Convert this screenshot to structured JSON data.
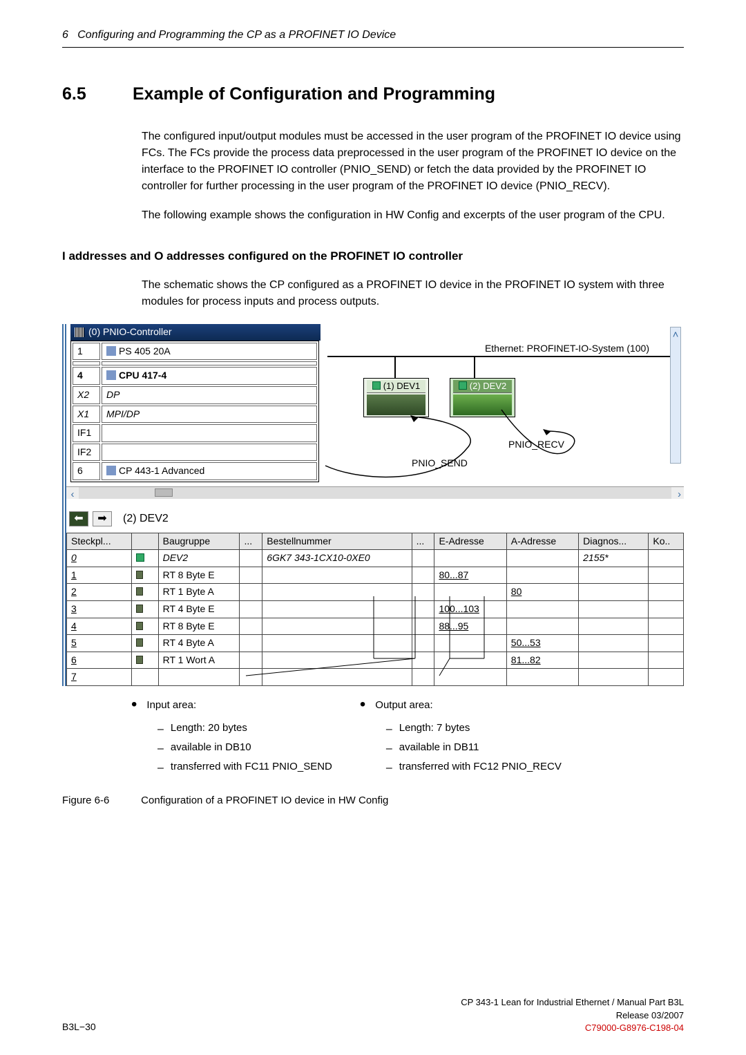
{
  "page_header": {
    "num": "6",
    "text": "Configuring and Programming the CP as a PROFINET IO Device"
  },
  "h1": {
    "num": "6.5",
    "title": "Example of Configuration and Programming"
  },
  "p1": "The configured input/output modules must be accessed in the user program of the PROFINET IO device using FCs. The FCs provide the process data preprocessed in the user program of the PROFINET IO device on the interface to the PROFINET IO controller (PNIO_SEND) or fetch the data provided by the PROFINET IO controller for further processing in the user program of the PROFINET IO device (PNIO_RECV).",
  "p2": "The following example shows the configuration in HW Config and excerpts of the user program of the CPU.",
  "h2": "I addresses and O addresses configured on the PROFINET IO controller",
  "p3": "The schematic shows the CP configured as a PROFINET IO device in the PROFINET IO system with three modules for process inputs and process outputs.",
  "hw": {
    "rack_title": "(0) PNIO-Controller",
    "rack_rows": [
      {
        "slot": "1",
        "name": "PS 405 20A",
        "b": true
      },
      {
        "slot": "",
        "name": ""
      },
      {
        "slot": "4",
        "name": "CPU 417-4",
        "b": true,
        "bold": true
      },
      {
        "slot": "X2",
        "name": "DP",
        "it": true
      },
      {
        "slot": "X1",
        "name": "MPI/DP",
        "it": true
      },
      {
        "slot": "IF1",
        "name": ""
      },
      {
        "slot": "IF2",
        "name": ""
      },
      {
        "slot": "6",
        "name": "CP 443-1 Advanced",
        "b": true
      }
    ],
    "net_label": "Ethernet: PROFINET-IO-System (100)",
    "dev1": "(1) DEV1",
    "dev2": "(2) DEV2",
    "pnio_send": "PNIO_SEND",
    "pnio_recv": "PNIO_RECV",
    "nav_label": "(2)  DEV2",
    "columns": [
      "Steckpl...",
      "",
      "Baugruppe",
      "...",
      "Bestellnummer",
      "...",
      "E-Adresse",
      "A-Adresse",
      "Diagnos...",
      "Ko.."
    ],
    "rows": [
      {
        "s": "0",
        "bg": "DEV2",
        "ord": "6GK7 343-1CX10-0XE0",
        "e": "",
        "a": "",
        "d": "2155*",
        "it": true,
        "icon": "dev"
      },
      {
        "s": "1",
        "bg": "RT    8 Byte E",
        "ord": "",
        "e": "80...87",
        "a": "",
        "d": ""
      },
      {
        "s": "2",
        "bg": "RT    1 Byte A",
        "ord": "",
        "e": "",
        "a": "80",
        "d": ""
      },
      {
        "s": "3",
        "bg": "RT    4 Byte E",
        "ord": "",
        "e": "100...103",
        "a": "",
        "d": ""
      },
      {
        "s": "4",
        "bg": "RT    8 Byte E",
        "ord": "",
        "e": "88...95",
        "a": "",
        "d": ""
      },
      {
        "s": "5",
        "bg": "RT    4 Byte A",
        "ord": "",
        "e": "",
        "a": "50...53",
        "d": ""
      },
      {
        "s": "6",
        "bg": "RT    1 Wort A",
        "ord": "",
        "e": "",
        "a": "81...82",
        "d": ""
      },
      {
        "s": "7",
        "bg": "",
        "ord": "",
        "e": "",
        "a": "",
        "d": ""
      }
    ]
  },
  "bullets": {
    "input": {
      "title": "Input area:",
      "items": [
        "Length: 20 bytes",
        "available in DB10",
        "transferred with FC11 PNIO_SEND"
      ]
    },
    "output": {
      "title": "Output area:",
      "items": [
        "Length: 7 bytes",
        "available in DB11",
        "transferred with FC12 PNIO_RECV"
      ]
    }
  },
  "figure": {
    "num": "Figure 6-6",
    "caption": "Configuration of a PROFINET IO device in HW Config"
  },
  "footer": {
    "left": "B3L−30",
    "r1": "CP 343-1 Lean for Industrial Ethernet / Manual Part B3L",
    "r2": "Release 03/2007",
    "r3": "C79000-G8976-C198-04"
  }
}
